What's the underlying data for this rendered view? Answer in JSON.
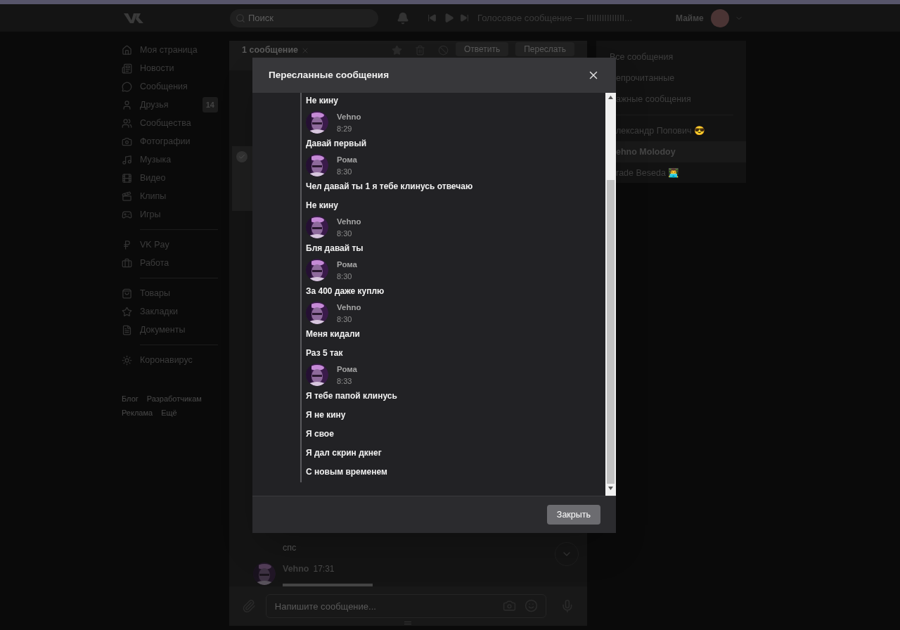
{
  "topbar": {
    "search": {
      "placeholder": "Поиск"
    },
    "player": {
      "track": "Голосовое сообщение — IIIIIIIIIIIIIII..."
    },
    "user": {
      "name": "Майме"
    }
  },
  "sidebar": {
    "groups": [
      {
        "items": [
          {
            "label": "Моя страница"
          },
          {
            "label": "Новости"
          },
          {
            "label": "Сообщения"
          },
          {
            "label": "Друзья",
            "badge": "14"
          },
          {
            "label": "Сообщества"
          },
          {
            "label": "Фотографии"
          },
          {
            "label": "Музыка"
          },
          {
            "label": "Видео"
          },
          {
            "label": "Клипы"
          },
          {
            "label": "Игры"
          }
        ]
      },
      {
        "items": [
          {
            "label": "VK Pay"
          },
          {
            "label": "Работа"
          }
        ]
      },
      {
        "items": [
          {
            "label": "Товары"
          },
          {
            "label": "Закладки"
          },
          {
            "label": "Документы"
          }
        ]
      },
      {
        "items": [
          {
            "label": "Коронавирус"
          }
        ]
      }
    ],
    "footer_links": [
      "Блог",
      "Разработчикам",
      "Реклама",
      "Ещё"
    ]
  },
  "conversation": {
    "header": {
      "selection": "1 сообщение",
      "buttons": [
        "Ответить",
        "Переслать"
      ]
    },
    "messages": [
      {
        "kind": "text",
        "text": "спс"
      },
      {
        "kind": "author",
        "name": "Vehno",
        "time": "17:31"
      }
    ],
    "composer": {
      "placeholder": "Напишите сообщение..."
    }
  },
  "right_panel": {
    "filters": [
      {
        "label": "Все сообщения"
      },
      {
        "label": "епрочитанные"
      },
      {
        "label": "ажные сообщения"
      }
    ],
    "chats": [
      {
        "label": "лександр Попович 😎",
        "selected": false
      },
      {
        "label": "ehno Molodoy",
        "selected": true
      },
      {
        "label": "rade Beseda 👨‍💻",
        "selected": false
      }
    ]
  },
  "modal": {
    "title": "Пересланные сообщения",
    "close_button": "Закрыть",
    "messages": [
      {
        "kind": "text",
        "text": "Не кину"
      },
      {
        "kind": "author",
        "name": "Vehno",
        "time": "8:29"
      },
      {
        "kind": "text",
        "text": "Давай первый"
      },
      {
        "kind": "author",
        "name": "Рома",
        "time": "8:30"
      },
      {
        "kind": "text",
        "text": "Чел давай ты 1 я тебе клинусь отвечаю"
      },
      {
        "kind": "text",
        "text": "Не кину"
      },
      {
        "kind": "author",
        "name": "Vehno",
        "time": "8:30"
      },
      {
        "kind": "text",
        "text": "Бля давай ты"
      },
      {
        "kind": "author",
        "name": "Рома",
        "time": "8:30"
      },
      {
        "kind": "text",
        "text": "За 400 даже куплю"
      },
      {
        "kind": "author",
        "name": "Vehno",
        "time": "8:30"
      },
      {
        "kind": "text",
        "text": "Меня кидали"
      },
      {
        "kind": "text",
        "text": "Раз 5 так"
      },
      {
        "kind": "author",
        "name": "Рома",
        "time": "8:33"
      },
      {
        "kind": "text",
        "text": "Я тебе папой клинусь"
      },
      {
        "kind": "text",
        "text": "Я не кину"
      },
      {
        "kind": "text",
        "text": "Я свое"
      },
      {
        "kind": "text",
        "text": "Я дал скрин дкнег"
      },
      {
        "kind": "text",
        "text": "С новым временем"
      }
    ]
  }
}
